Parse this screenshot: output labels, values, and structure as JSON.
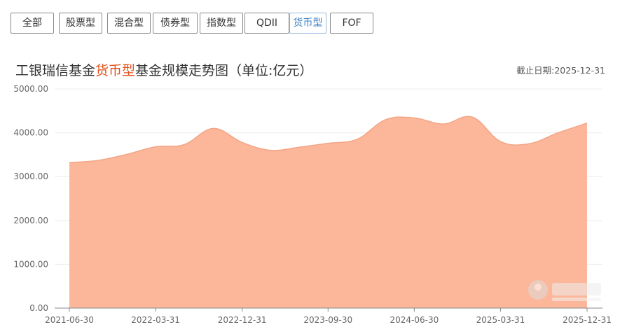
{
  "tabs": [
    {
      "label": "全部",
      "active": false
    },
    {
      "label": "股票型",
      "active": false
    },
    {
      "label": "混合型",
      "active": false
    },
    {
      "label": "债券型",
      "active": false
    },
    {
      "label": "指数型",
      "active": false
    },
    {
      "label": "QDII",
      "active": false
    },
    {
      "label": "货币型",
      "active": true
    },
    {
      "label": "FOF",
      "active": false
    }
  ],
  "header": {
    "title_pre": "工银瑞信基金",
    "title_highlight": "货币型",
    "title_post": "基金规模走势图（单位:亿元）",
    "date_label": "截止日期:2025-12-31"
  },
  "colors": {
    "fill": "#fcb79a",
    "stroke": "#f3a585",
    "highlight": "#e2531d",
    "active_tab": "#3d7fc4"
  },
  "chart_data": {
    "type": "area",
    "title": "工银瑞信基金货币型基金规模走势图（单位:亿元）",
    "xlabel": "",
    "ylabel": "",
    "ylim": [
      0,
      5000
    ],
    "ytick_labels": [
      "0.00",
      "1000.00",
      "2000.00",
      "3000.00",
      "4000.00",
      "5000.00"
    ],
    "xtick_labels": [
      "2021-06-30",
      "2022-03-31",
      "2022-12-31",
      "2023-09-30",
      "2024-06-30",
      "2025-03-31",
      "2025-12-31"
    ],
    "x": [
      "2021-06-30",
      "2021-09-30",
      "2021-12-31",
      "2022-03-31",
      "2022-06-30",
      "2022-09-30",
      "2022-12-31",
      "2023-03-31",
      "2023-06-30",
      "2023-09-30",
      "2023-12-31",
      "2024-03-31",
      "2024-06-30",
      "2024-09-30",
      "2024-12-31",
      "2025-03-31",
      "2025-06-30",
      "2025-09-30",
      "2025-12-31"
    ],
    "values": [
      3320,
      3370,
      3510,
      3680,
      3730,
      4100,
      3780,
      3600,
      3670,
      3760,
      3850,
      4300,
      4340,
      4200,
      4360,
      3800,
      3750,
      4000,
      4220
    ],
    "grid": true,
    "legend": "none"
  }
}
